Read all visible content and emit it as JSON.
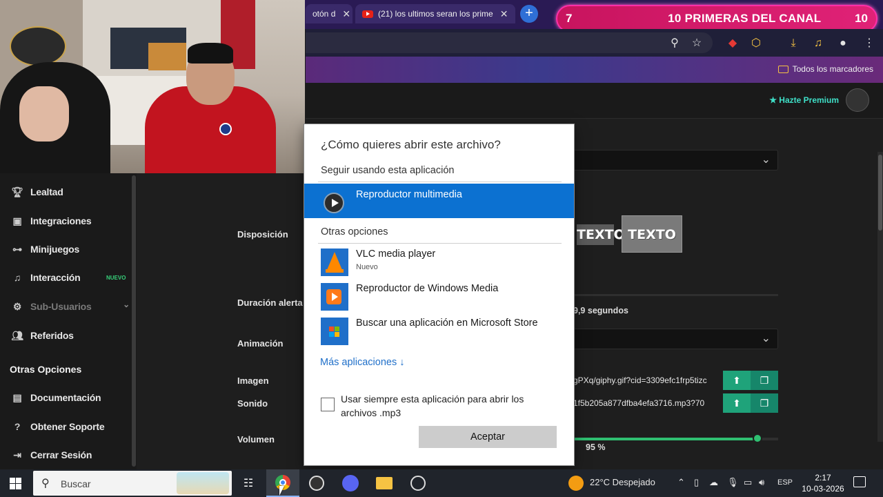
{
  "browser": {
    "tabs": [
      {
        "label": "otón d"
      },
      {
        "label": "(21) los ultimos seran los prime"
      }
    ],
    "new_tab": "+",
    "bookmarks_all": "Todos los marcadores",
    "window_min": "—",
    "window_restore": "❐"
  },
  "goal_banner": {
    "left": "7",
    "title": "10 PRIMERAS DEL CANAL",
    "right": "10"
  },
  "header": {
    "premium": "Hazte Premium"
  },
  "sidebar": {
    "items": [
      {
        "label": "Lealtad",
        "icon": "trophy-icon"
      },
      {
        "label": "Integraciones",
        "icon": "plug-icon"
      },
      {
        "label": "Minijuegos",
        "icon": "gamepad-icon"
      },
      {
        "label": "Interacción",
        "icon": "music-icon",
        "badge": "NUEVO"
      },
      {
        "label": "Sub-Usuarios",
        "icon": "users-icon"
      },
      {
        "label": "Referidos",
        "icon": "user-group-icon"
      }
    ],
    "section": "Otras Opciones",
    "other": [
      {
        "label": "Documentación",
        "icon": "document-icon"
      },
      {
        "label": "Obtener Soporte",
        "icon": "help-icon"
      },
      {
        "label": "Cerrar Sesión",
        "icon": "logout-icon"
      }
    ]
  },
  "form": {
    "disposicion": "Disposición",
    "duracion": "Duración alerta",
    "duracion_value": "9,9",
    "duracion_unit": "segundos",
    "animacion": "Animación",
    "imagen": "Imagen",
    "imagen_value": "gPXq/giphy.gif?cid=3309efc1frp5tizc",
    "sonido": "Sonido",
    "sonido_value": "1f5b205a877dfba4efa3716.mp3?70",
    "volumen": "Volumen",
    "volumen_value": "95 %",
    "volumen_level": 0.9,
    "layout_text_a": "TEXTO",
    "layout_text_b": "TEXTO"
  },
  "dialog": {
    "title": "¿Cómo quieres abrir este archivo?",
    "keep_using": "Seguir usando esta aplicación",
    "selected_app": "Reproductor multimedia",
    "other_options": "Otras opciones",
    "apps": [
      {
        "name": "VLC media player",
        "sub": "Nuevo"
      },
      {
        "name": "Reproductor de Windows Media",
        "sub": ""
      },
      {
        "name": "Buscar una aplicación en Microsoft Store",
        "sub": ""
      }
    ],
    "more_apps": "Más aplicaciones ↓",
    "always_use": "Usar siempre esta aplicación para abrir los archivos .mp3",
    "accept": "Aceptar"
  },
  "taskbar": {
    "search": "Buscar",
    "weather": "22°C  Despejado",
    "lang": "ESP",
    "time": "2:17",
    "date": "10-03-2026"
  },
  "colors": {
    "accent": "#0c71d1",
    "green": "#1fa37a",
    "premium": "#3fe0c8",
    "banner": "#e02277"
  }
}
